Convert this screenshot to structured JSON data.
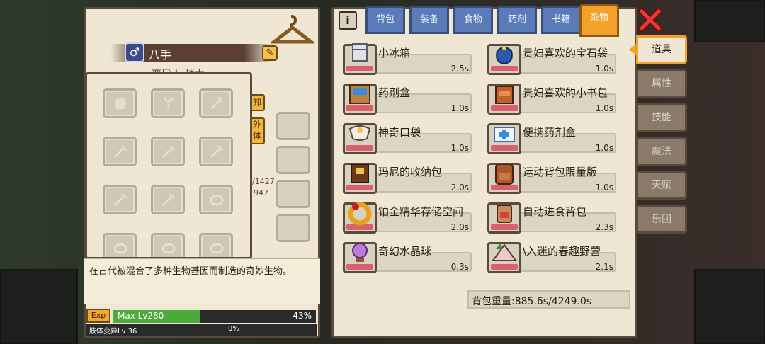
{
  "character": {
    "gender_symbol": "♂",
    "name": "八手",
    "subtitle": "变异人 战士",
    "description": "在古代被混合了多种生物基因而制造的奇妙生物。",
    "exp_tag": "Exp",
    "level_label": "Max Lv280",
    "exp_percent": "43%",
    "exp_fill": 0.43,
    "mutation_label": "肢体变异Lv 36",
    "mutation_percent": "0%",
    "side_tag_unload": "卸",
    "side_tag_outer": "外体",
    "stat_a": "/1427",
    "stat_b": "947"
  },
  "tabs": [
    {
      "label": "背包",
      "active": false
    },
    {
      "label": "装备",
      "active": false
    },
    {
      "label": "食物",
      "active": false
    },
    {
      "label": "药剂",
      "active": false
    },
    {
      "label": "书籍",
      "active": false
    },
    {
      "label": "杂物",
      "active": true
    }
  ],
  "items_left": [
    {
      "name": "小冰箱",
      "time": "2.5s",
      "icon": "mini-fridge-icon"
    },
    {
      "name": "药剂盒",
      "time": "1.0s",
      "icon": "potion-box-icon"
    },
    {
      "name": "神奇口袋",
      "time": "1.0s",
      "icon": "magic-pocket-icon"
    },
    {
      "name": "玛尼的收纳包",
      "time": "2.0s",
      "icon": "storage-bag-icon"
    },
    {
      "name": "铂金精华存储空间",
      "time": "2.0s",
      "icon": "platinum-ring-icon"
    },
    {
      "name": "奇幻水晶球",
      "time": "0.3s",
      "icon": "crystal-ball-icon"
    }
  ],
  "items_right": [
    {
      "name": "贵妇喜欢的宝石袋",
      "time": "1.0s",
      "icon": "gem-pouch-icon"
    },
    {
      "name": "贵妇喜欢的小书包",
      "time": "1.0s",
      "icon": "school-bag-icon"
    },
    {
      "name": "便携药剂盒",
      "time": "1.0s",
      "icon": "portable-medkit-icon"
    },
    {
      "name": "运动背包限量版",
      "time": "1.0s",
      "icon": "sport-backpack-icon"
    },
    {
      "name": "自动进食背包",
      "time": "2.3s",
      "icon": "auto-feed-backpack-icon"
    },
    {
      "name": "\\入迷的春趣野营",
      "time": "2.1s",
      "icon": "camping-tent-icon"
    }
  ],
  "bag_weight": "背包重量:885.6s/4249.0s",
  "side_nav": [
    {
      "label": "道具",
      "active": true
    },
    {
      "label": "属性",
      "active": false
    },
    {
      "label": "技能",
      "active": false
    },
    {
      "label": "魔法",
      "active": false
    },
    {
      "label": "天赋",
      "active": false
    },
    {
      "label": "乐团",
      "active": false
    }
  ],
  "colors": {
    "tab_active": "#f2a22a",
    "tab_inactive": "#5a7ab8",
    "exp_fill": "#4caa3a",
    "panel_bg": "#efe7d4"
  }
}
